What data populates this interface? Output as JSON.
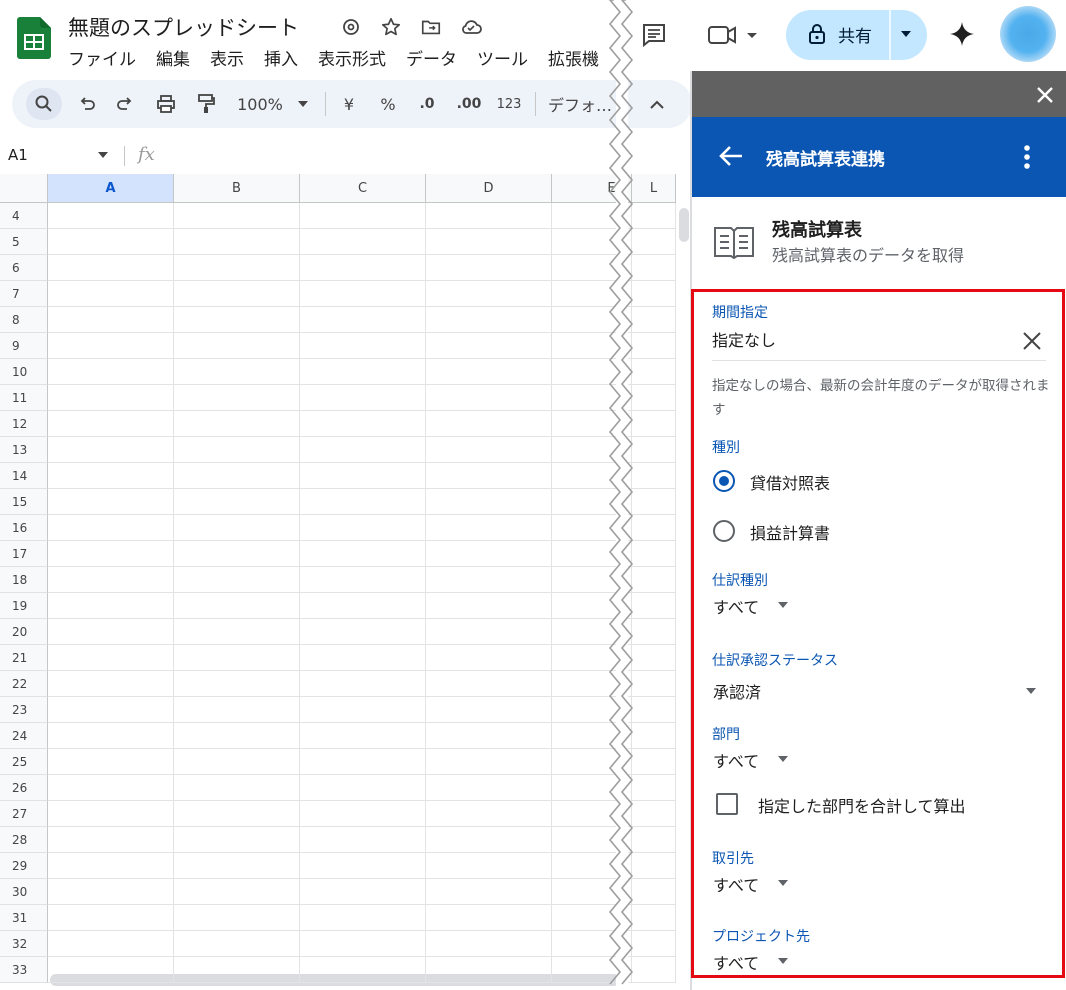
{
  "app": {
    "doc_title": "無題のスプレッドシート",
    "menu": [
      "ファイル",
      "編集",
      "表示",
      "挿入",
      "表示形式",
      "データ",
      "ツール",
      "拡張機"
    ]
  },
  "toolbar": {
    "zoom": "100%",
    "currency": "¥",
    "percent": "%",
    "decimal_decrease": ".0",
    "decimal_increase": ".00",
    "number_format": "123",
    "font": "デフォ…"
  },
  "formula_bar": {
    "name_box": "A1",
    "fx": "fx"
  },
  "grid": {
    "columns": [
      "A",
      "B",
      "C",
      "D",
      "E",
      "L"
    ],
    "rows": [
      "4",
      "5",
      "6",
      "7",
      "8",
      "9",
      "10",
      "11",
      "12",
      "13",
      "14",
      "15",
      "16",
      "17",
      "18",
      "19",
      "20",
      "21",
      "22",
      "23",
      "24",
      "25",
      "26",
      "27",
      "28",
      "29",
      "30",
      "31",
      "32",
      "33"
    ],
    "selected_column": "A"
  },
  "header_right": {
    "share_label": "共有"
  },
  "panel": {
    "title": "残高試算表連携",
    "section_title": "残高試算表",
    "section_subtitle": "残高試算表のデータを取得",
    "period": {
      "label": "期間指定",
      "value": "指定なし",
      "help": "指定なしの場合、最新の会計年度のデータが取得されます"
    },
    "type": {
      "label": "種別",
      "options": [
        "貸借対照表",
        "損益計算書"
      ],
      "selected": "貸借対照表"
    },
    "journal_type": {
      "label": "仕訳種別",
      "value": "すべて"
    },
    "approval_status": {
      "label": "仕訳承認ステータス",
      "value": "承認済"
    },
    "department": {
      "label": "部門",
      "value": "すべて",
      "checkbox_label": "指定した部門を合計して算出",
      "checked": false
    },
    "partner": {
      "label": "取引先",
      "value": "すべて"
    },
    "project": {
      "label": "プロジェクト先",
      "value": "すべて"
    }
  },
  "colors": {
    "panel_header": "#0b56b3",
    "panel_top": "#616161",
    "share_bg": "#c2e7ff",
    "highlight_border": "#e50914",
    "sheets_green": "#188038"
  }
}
